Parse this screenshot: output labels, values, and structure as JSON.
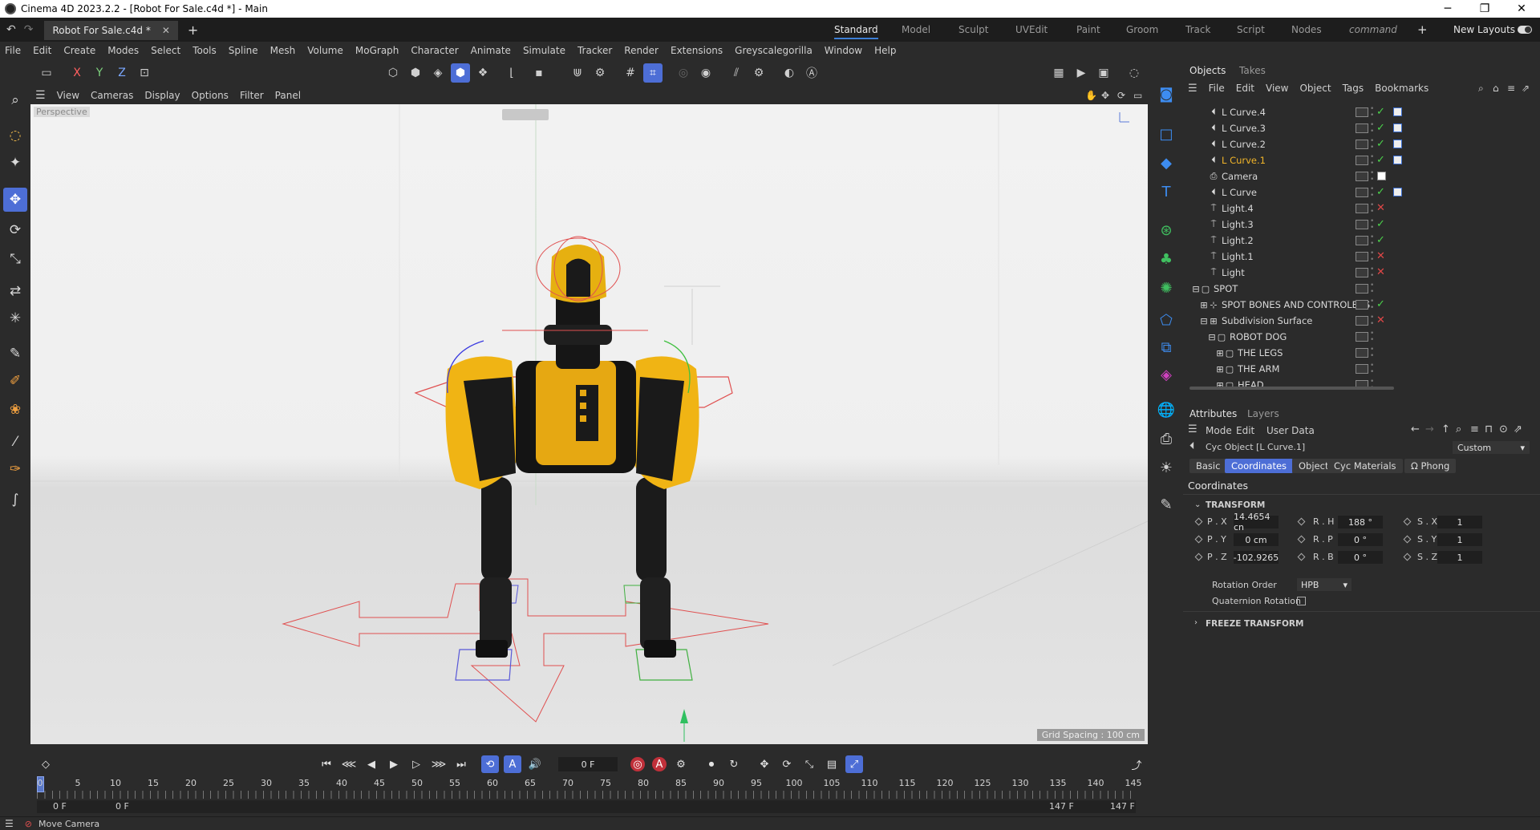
{
  "window": {
    "title": "Cinema 4D 2023.2.2 - [Robot For Sale.c4d *] - Main"
  },
  "tabs": {
    "doc_tab": "Robot For Sale.c4d *",
    "layouts": [
      "Standard",
      "Model",
      "Sculpt",
      "UVEdit",
      "Paint",
      "Groom",
      "Track",
      "Script",
      "Nodes",
      "command"
    ],
    "new_layouts": "New Layouts"
  },
  "menu": [
    "File",
    "Edit",
    "Create",
    "Modes",
    "Select",
    "Tools",
    "Spline",
    "Mesh",
    "Volume",
    "MoGraph",
    "Character",
    "Animate",
    "Simulate",
    "Tracker",
    "Render",
    "Extensions",
    "Greyscalegorilla",
    "Window",
    "Help"
  ],
  "axis_buttons": [
    "X",
    "Y",
    "Z"
  ],
  "viewport": {
    "menu": [
      "View",
      "Cameras",
      "Display",
      "Options",
      "Filter",
      "Panel"
    ],
    "label": "Perspective",
    "grid_spacing": "Grid Spacing : 100 cm"
  },
  "timeline": {
    "current_frame": "0 F",
    "ticks": [
      "0",
      "5",
      "10",
      "15",
      "20",
      "25",
      "30",
      "35",
      "40",
      "45",
      "50",
      "55",
      "60",
      "65",
      "70",
      "75",
      "80",
      "85",
      "90",
      "95",
      "100",
      "105",
      "110",
      "115",
      "120",
      "125",
      "130",
      "135",
      "140",
      "145"
    ],
    "range_start": "0 F",
    "range_start2": "0 F",
    "range_end": "147 F",
    "range_end2": "147 F"
  },
  "status": {
    "text": "Move Camera"
  },
  "objects_panel": {
    "tabs": [
      "Objects",
      "Takes"
    ],
    "menu": [
      "File",
      "Edit",
      "View",
      "Object",
      "Tags",
      "Bookmarks"
    ],
    "rows": [
      {
        "name": "L Curve.4",
        "status": "✓"
      },
      {
        "name": "L Curve.3",
        "status": "✓"
      },
      {
        "name": "L Curve.2",
        "status": "✓"
      },
      {
        "name": "L Curve.1",
        "status": "✓"
      },
      {
        "name": "Camera",
        "status": ""
      },
      {
        "name": "L Curve",
        "status": "✓"
      },
      {
        "name": "Light.4",
        "status": "✕"
      },
      {
        "name": "Light.3",
        "status": "✓"
      },
      {
        "name": "Light.2",
        "status": "✓"
      },
      {
        "name": "Light.1",
        "status": "✕"
      },
      {
        "name": "Light",
        "status": "✕"
      },
      {
        "name": "SPOT",
        "status": ""
      },
      {
        "name": "SPOT BONES AND CONTROLERS",
        "status": "✓"
      },
      {
        "name": "Subdivision Surface",
        "status": "✕"
      },
      {
        "name": "ROBOT DOG",
        "status": ""
      },
      {
        "name": "THE LEGS",
        "status": ""
      },
      {
        "name": "THE ARM",
        "status": ""
      },
      {
        "name": "HEAD",
        "status": ""
      }
    ]
  },
  "attributes_panel": {
    "tabs": [
      "Attributes",
      "Layers"
    ],
    "menu": [
      "Mode",
      "Edit",
      "User Data"
    ],
    "object_title": "Cyc Object [L Curve.1]",
    "preset": "Custom",
    "sub_tabs": [
      "Basic",
      "Coordinates",
      "Object",
      "Cyc Materials",
      "Ω Phong"
    ],
    "section": "Coordinates",
    "group": "TRANSFORM",
    "coords": {
      "px_label": "P . X",
      "px": "14.4654 cn",
      "py_label": "P . Y",
      "py": "0 cm",
      "pz_label": "P . Z",
      "pz": "-102.9265",
      "rh_label": "R . H",
      "rh": "188 °",
      "rp_label": "R . P",
      "rp": "0 °",
      "rb_label": "R . B",
      "rb": "0 °",
      "sx_label": "S . X",
      "sx": "1",
      "sy_label": "S . Y",
      "sy": "1",
      "sz_label": "S . Z",
      "sz": "1"
    },
    "rotation_order_label": "Rotation Order",
    "rotation_order": "HPB",
    "quaternion_label": "Quaternion Rotation",
    "freeze": "FREEZE TRANSFORM"
  },
  "colors": {
    "accent": "#4d6ed6",
    "selected_text": "#f0b429",
    "check": "#4bd24b",
    "cross": "#e04747"
  }
}
